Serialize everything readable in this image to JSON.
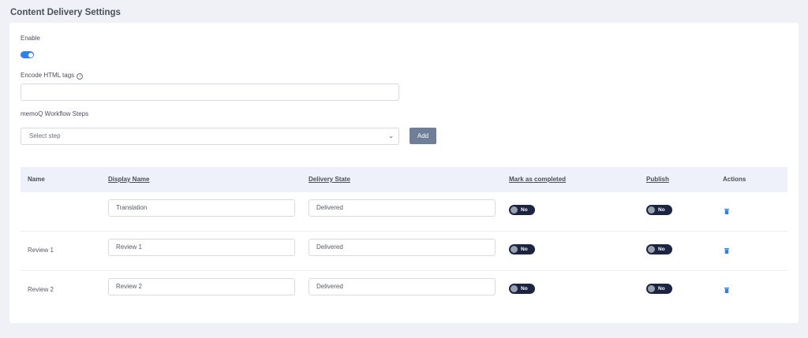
{
  "page": {
    "title": "Content Delivery Settings"
  },
  "enable": {
    "label": "Enable",
    "value": true
  },
  "encode_html": {
    "label": "Encode HTML tags",
    "info_icon": "info-circle-icon",
    "value": ""
  },
  "workflow": {
    "label": "memoQ Workflow Steps",
    "select_placeholder": "Select step",
    "add_label": "Add"
  },
  "table": {
    "headers": {
      "name": "Name",
      "display_name": "Display Name",
      "delivery_state": "Delivery State",
      "mark_completed": "Mark as completed",
      "publish": "Publish",
      "actions": "Actions"
    },
    "rows": [
      {
        "name": "",
        "display_name": "Translation",
        "delivery_state": "Delivered",
        "mark_completed": "No",
        "publish": "No"
      },
      {
        "name": "Review 1",
        "display_name": "Review 1",
        "delivery_state": "Delivered",
        "mark_completed": "No",
        "publish": "No"
      },
      {
        "name": "Review 2",
        "display_name": "Review 2",
        "delivery_state": "Delivered",
        "mark_completed": "No",
        "publish": "No"
      }
    ]
  },
  "colors": {
    "accent": "#2f80ed",
    "toggle_off_bg": "#1b2440",
    "button": "#6f7f99",
    "header_bg": "#eef1f9"
  }
}
